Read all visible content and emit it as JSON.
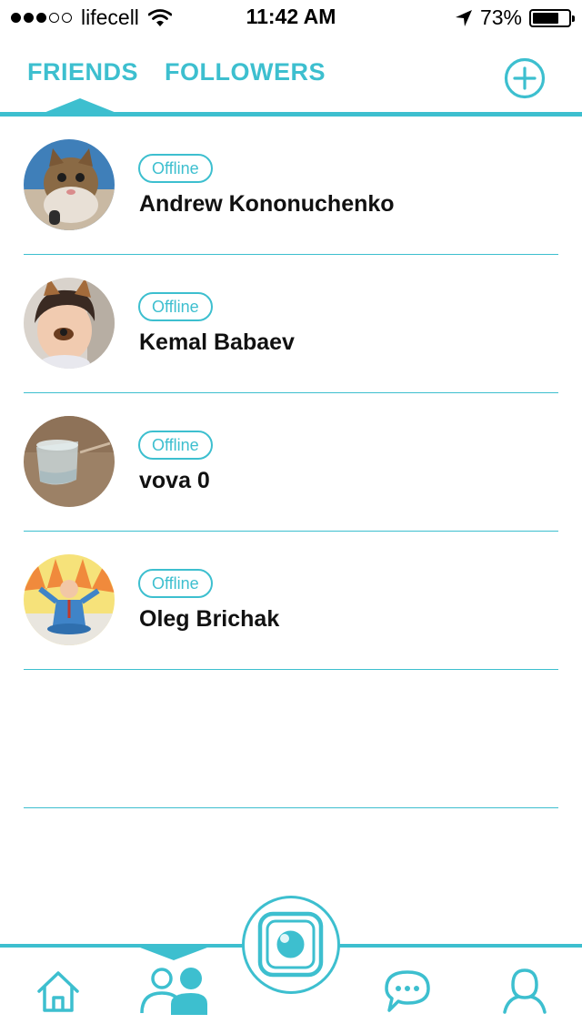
{
  "status_bar": {
    "signal_bars_filled": 3,
    "signal_bars_total": 5,
    "carrier": "lifecell",
    "time": "11:42 AM",
    "battery_percent": "73%",
    "battery_level": 0.73,
    "icons": [
      "wifi-icon",
      "location-arrow-icon",
      "battery-icon"
    ]
  },
  "top_nav": {
    "tabs": [
      {
        "label": "FRIENDS",
        "selected": true
      },
      {
        "label": "FOLLOWERS",
        "selected": false
      }
    ],
    "add_icon": "plus-circle-icon"
  },
  "friends": [
    {
      "status": "Offline",
      "name": "Andrew Kononuchenko"
    },
    {
      "status": "Offline",
      "name": "Kemal Babaev"
    },
    {
      "status": "Offline",
      "name": "vova 0"
    },
    {
      "status": "Offline",
      "name": "Oleg Brichak"
    }
  ],
  "bottom_tabs": {
    "items": [
      "home-icon",
      "friends-icon",
      "camera-icon",
      "chat-icon",
      "profile-icon"
    ],
    "selected": "friends-icon"
  },
  "colors": {
    "accent": "#3dbfcf",
    "text": "#111111",
    "background": "#ffffff"
  }
}
